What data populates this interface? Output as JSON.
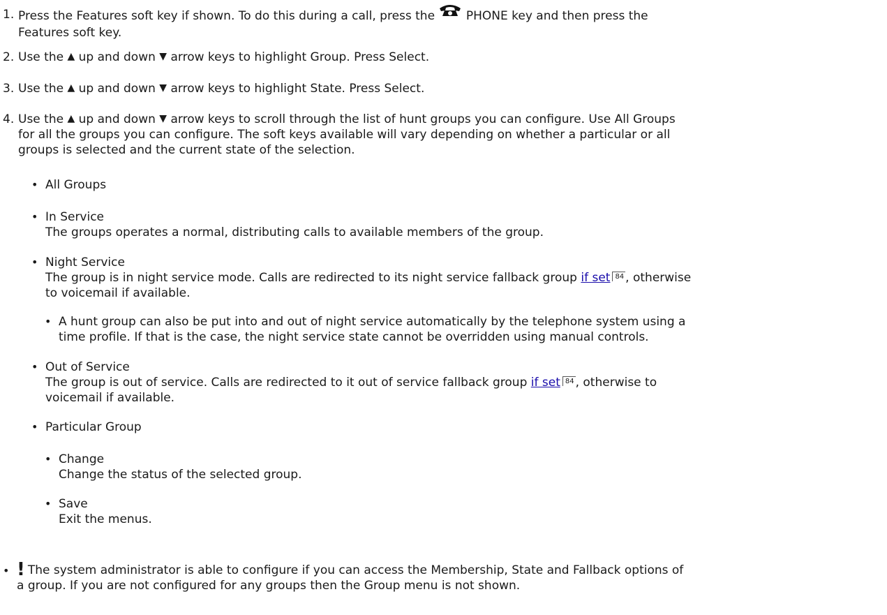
{
  "steps": [
    {
      "num": "1.",
      "text_a": "Press the Features soft key if shown. To do this during a call, press the ",
      "text_b": " PHONE key and then press the",
      "text_c": "Features soft key."
    },
    {
      "num": "2.",
      "text_a": "Use the ",
      "text_b": " up and down ",
      "text_c": " arrow keys to highlight Group. Press Select."
    },
    {
      "num": "3.",
      "text_a": "Use the ",
      "text_b": " up and down ",
      "text_c": " arrow keys to highlight State. Press Select."
    },
    {
      "num": "4.",
      "text_a": "Use the ",
      "text_b": " up and down ",
      "text_c": " arrow keys to scroll through the list of hunt groups you can configure. Use All Groups",
      "line2": "for all the groups you can configure. The soft keys available will vary depending on whether a particular or all",
      "line3": "groups is selected and the current state of the selection."
    }
  ],
  "glyphs": {
    "up_arrow": "▲",
    "down_arrow": "▼",
    "bullet": "•",
    "warning": "!"
  },
  "states": {
    "all_groups": {
      "title": "All Groups"
    },
    "in_service": {
      "title": "In Service",
      "desc": "The groups operates a normal, distributing calls to available members of the group."
    },
    "night_service": {
      "title": "Night Service",
      "desc_a": "The group is in night service mode. Calls are redirected to its night service fallback group ",
      "link": "if set",
      "page_ref": "84",
      "desc_b": ", otherwise",
      "desc_line2": "to voicemail if available.",
      "note_line1": "A hunt group can also be put into and out of night service automatically by the telephone system using a",
      "note_line2": "time profile. If that is the case, the night service state cannot be overridden using manual controls."
    },
    "out_of_service": {
      "title": "Out of Service",
      "desc_a": "The group is out of service. Calls are redirected to it out of service fallback group ",
      "link": "if set",
      "page_ref": "84",
      "desc_b": ", otherwise to",
      "desc_line2": "voicemail if available."
    },
    "particular_group": {
      "title": "Particular Group"
    },
    "change": {
      "title": "Change",
      "desc": "Change the status of the selected group."
    },
    "save": {
      "title": "Save",
      "desc": "Exit the menus."
    }
  },
  "warning": {
    "line1": "The system administrator is able to configure if you can access the Membership, State and Fallback options of",
    "line2": "a group. If you are not configured for any groups then the Group menu is not shown."
  },
  "icons": {
    "phone": "phone-icon",
    "up": "up-arrow-icon",
    "down": "down-arrow-icon",
    "warning": "warning-icon"
  }
}
